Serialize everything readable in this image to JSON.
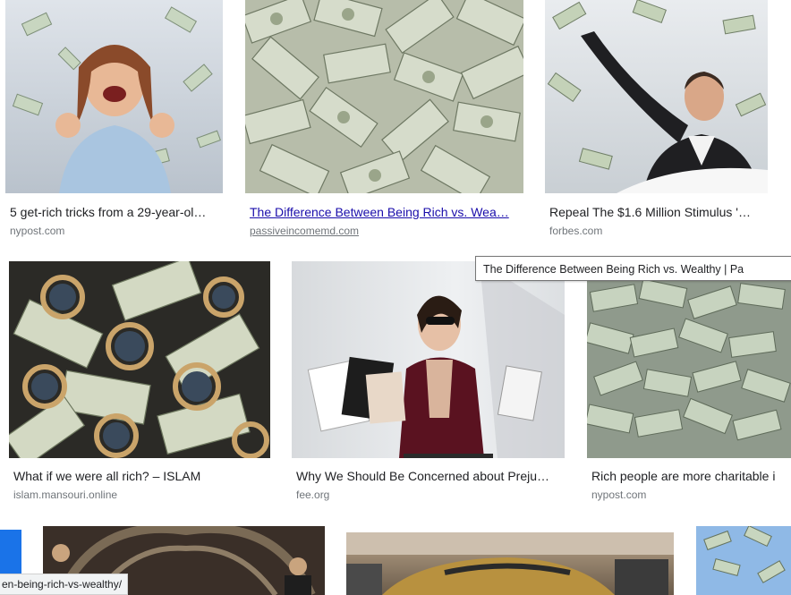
{
  "results": [
    {
      "title": "5 get-rich tricks from a 29-year-ol…",
      "source": "nypost.com",
      "visited": false
    },
    {
      "title": "The Difference Between Being Rich vs. Wea…",
      "source": "passiveincomemd.com",
      "visited": true
    },
    {
      "title": "Repeal The $1.6 Million Stimulus '…",
      "source": "forbes.com",
      "visited": false
    },
    {
      "title": "What if we were all rich? – ISLAM",
      "source": "islam.mansouri.online",
      "visited": false
    },
    {
      "title": "Why We Should Be Concerned about Preju…",
      "source": "fee.org",
      "visited": false
    },
    {
      "title": "Rich people are more charitable i",
      "source": "nypost.com",
      "visited": false
    }
  ],
  "tooltip": "The Difference Between Being Rich vs. Wealthy | Pa",
  "status_url": "en-being-rich-vs-wealthy/",
  "colors": {
    "link": "#1a0dab",
    "text": "#202124",
    "source": "#70757a"
  }
}
